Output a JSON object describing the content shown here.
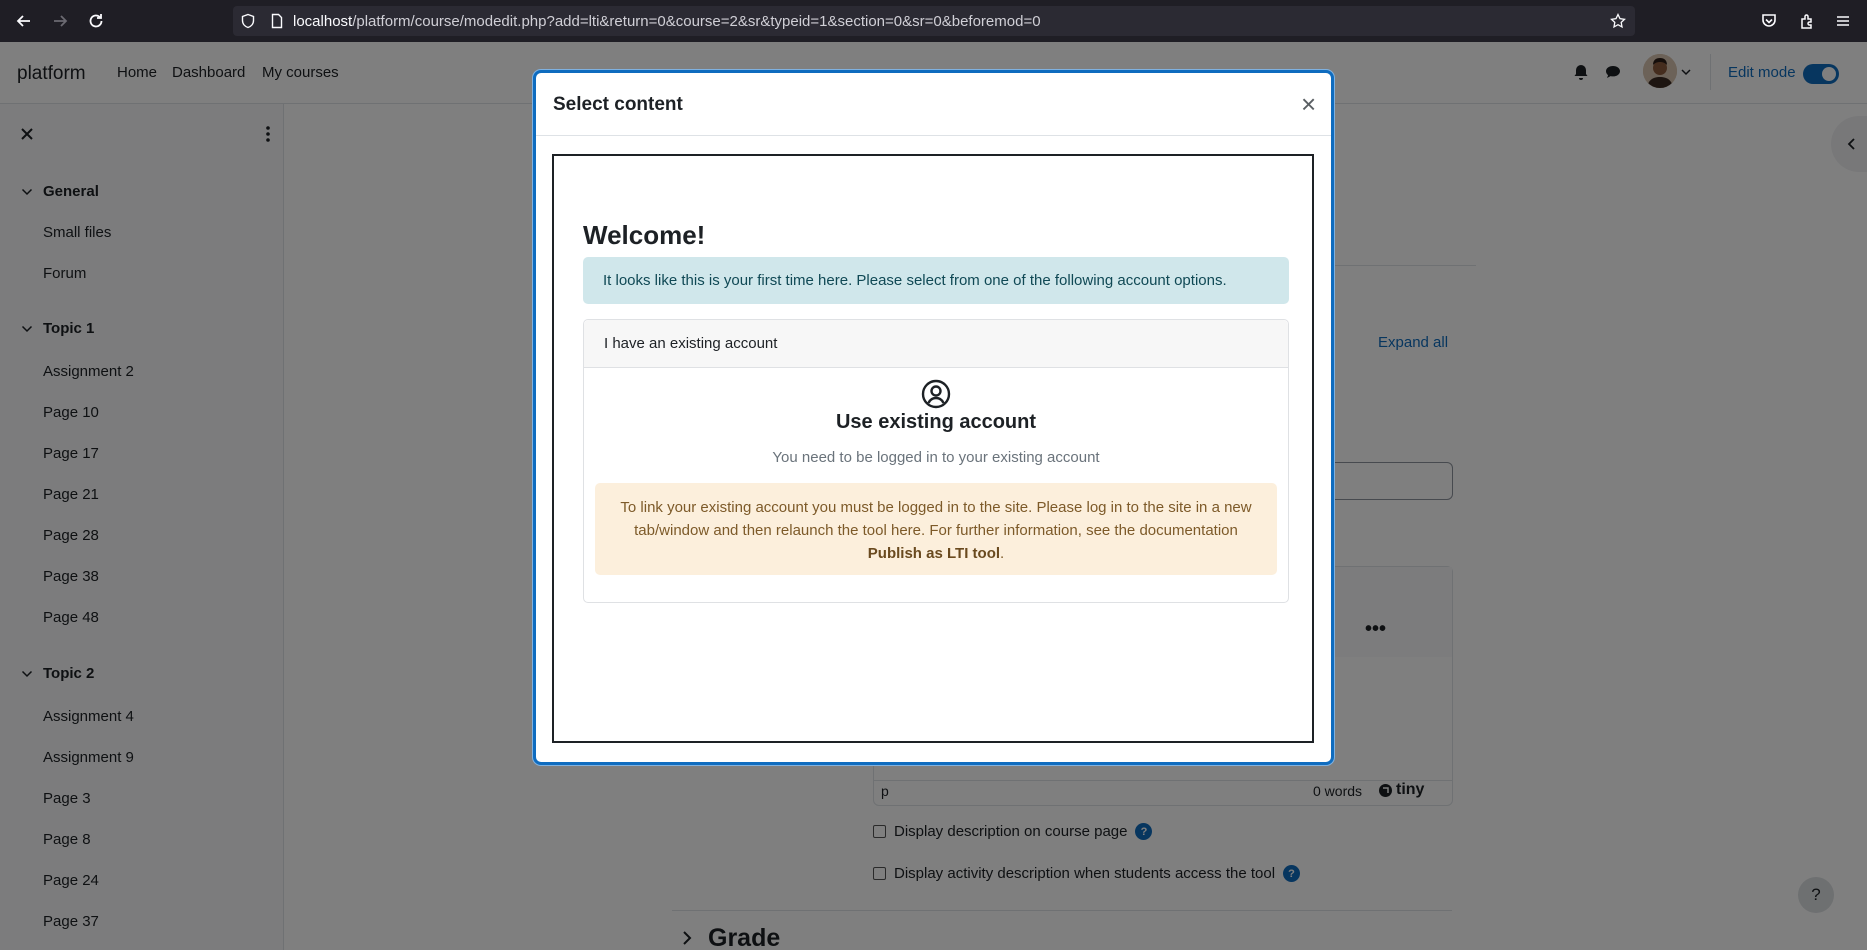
{
  "browser": {
    "url_host": "localhost",
    "url_path": "/platform/course/modedit.php?add=lti&return=0&course=2&sr&typeid=1&section=0&sr=0&beforemod=0"
  },
  "navbar": {
    "brand": "platform",
    "links": [
      "Home",
      "Dashboard",
      "My courses"
    ],
    "edit_mode_label": "Edit mode"
  },
  "drawer": {
    "sections": [
      {
        "title": "General",
        "items": [
          "Small files",
          "Forum"
        ]
      },
      {
        "title": "Topic 1",
        "items": [
          "Assignment 2",
          "Page 10",
          "Page 17",
          "Page 21",
          "Page 28",
          "Page 38",
          "Page 48"
        ]
      },
      {
        "title": "Topic 2",
        "items": [
          "Assignment 4",
          "Assignment 9",
          "Page 3",
          "Page 8",
          "Page 24",
          "Page 37"
        ]
      }
    ]
  },
  "main": {
    "expand_all": "Expand all",
    "editor": {
      "more": "•••",
      "path": "p",
      "words": "0 words",
      "brand": "tiny"
    },
    "checkboxes": [
      "Display description on course page",
      "Display activity description when students access the tool"
    ],
    "help_mark": "?",
    "grade_heading": "Grade",
    "floating_help": "?"
  },
  "modal": {
    "title": "Select content",
    "close": "×",
    "welcome": "Welcome!",
    "info": "It looks like this is your first time here. Please select from one of the following account options.",
    "card_header": "I have an existing account",
    "card_title": "Use existing account",
    "card_subtitle": "You need to be logged in to your existing account",
    "warning_text": "To link your existing account you must be logged in to the site. Please log in to the site in a new tab/window and then relaunch the tool here. For further information, see the documentation",
    "warning_link": "Publish as LTI tool",
    "warning_end": "."
  },
  "colors": {
    "accent": "#0f6cbf",
    "info_bg": "#d0e7eb",
    "warning_bg": "#fcefdc",
    "browser_bg": "#1f1e25"
  }
}
